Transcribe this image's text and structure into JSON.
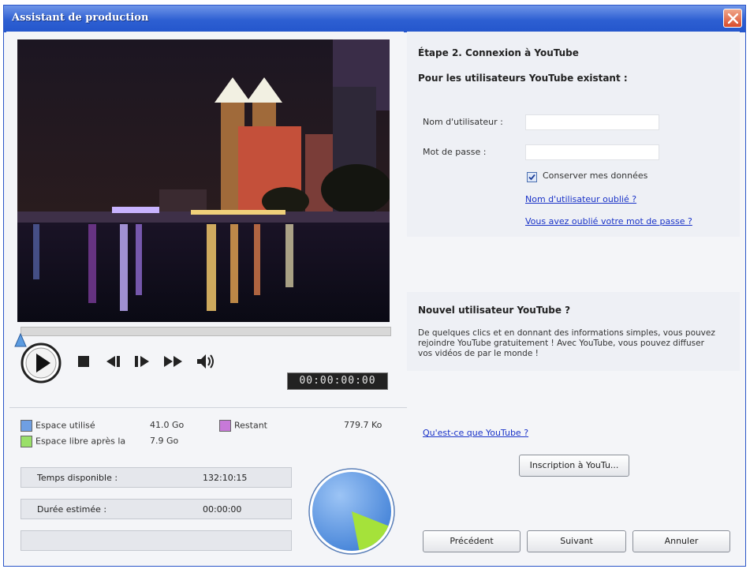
{
  "window": {
    "title": "Assistant de production"
  },
  "player": {
    "timecode": "00:00:00:00"
  },
  "storage": {
    "used_label": "Espace utilisé",
    "used_value": "41.0 Go",
    "free_after_label": "Espace libre après la",
    "free_after_value": "7.9 Go",
    "remaining_label": "Restant",
    "remaining_value": "779.7 Ko",
    "colors": {
      "used": "#6f9fe3",
      "free_after": "#9ae069",
      "remaining": "#c779d8"
    }
  },
  "info": {
    "time_available_label": "Temps disponible :",
    "time_available_value": "132:10:15",
    "estimated_duration_label": "Durée estimée :",
    "estimated_duration_value": "00:00:00"
  },
  "pie": {
    "used_fraction": 0.84,
    "free_fraction": 0.16
  },
  "youtube": {
    "step_title": "Étape 2. Connexion à YouTube",
    "existing_heading": "Pour les utilisateurs YouTube existant :",
    "username_label": "Nom d'utilisateur :",
    "username_value": "",
    "password_label": "Mot de passe :",
    "password_value": "",
    "remember_label": "Conserver mes données",
    "forgot_username": "Nom d'utilisateur oublié ?",
    "forgot_password": "Vous avez oublié votre mot de passe ?",
    "new_heading": "Nouvel utilisateur YouTube ?",
    "new_desc": "De quelques clics et en donnant des informations simples, vous pouvez rejoindre YouTube gratuitement ! Avec YouTube, vous pouvez diffuser vos vidéos de par le monde !",
    "what_is": "Qu'est-ce que YouTube ?",
    "signup_button": "Inscription à YouTu..."
  },
  "footer": {
    "previous": "Précédent",
    "next": "Suivant",
    "cancel": "Annuler"
  }
}
